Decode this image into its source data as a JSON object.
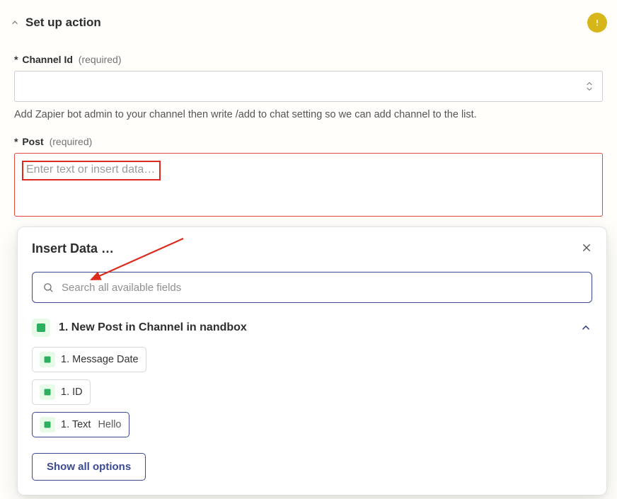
{
  "header": {
    "title": "Set up action"
  },
  "fields": {
    "channel": {
      "label": "Channel Id",
      "required_text": "(required)",
      "helper": "Add Zapier bot admin to your channel then write /add to chat setting so we can add channel to the list."
    },
    "post": {
      "label": "Post",
      "required_text": "(required)",
      "placeholder": "Enter text or insert data…"
    }
  },
  "insert_panel": {
    "title": "Insert Data …",
    "search_placeholder": "Search all available fields",
    "source": {
      "title": "1. New Post in Channel in nandbox"
    },
    "items": [
      {
        "label": "1. Message Date",
        "value": "",
        "selected": false
      },
      {
        "label": "1. ID",
        "value": "",
        "selected": false
      },
      {
        "label": "1. Text",
        "value": "Hello",
        "selected": true
      }
    ],
    "show_all": "Show all options"
  }
}
